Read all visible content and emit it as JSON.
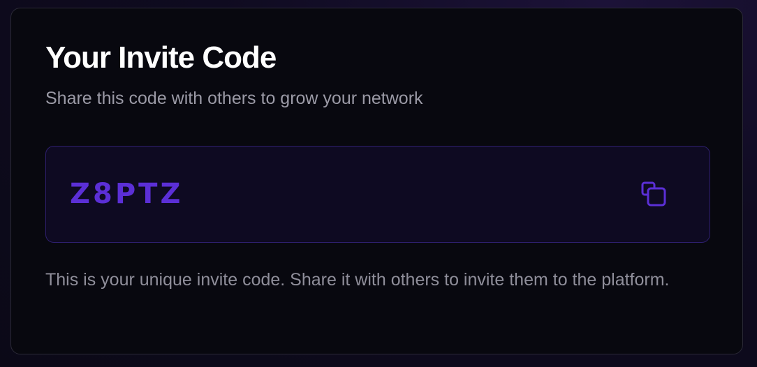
{
  "card": {
    "title": "Your Invite Code",
    "subtitle": "Share this code with others to grow your network",
    "invite_code": "Z8PTZ",
    "copy_icon": "copy-icon",
    "footnote": "This is your unique invite code. Share it with others to invite them to the platform."
  },
  "colors": {
    "accent": "#5b2fd6",
    "card_background": "#08080f",
    "code_box_background": "#0e0a22",
    "code_box_border": "#2e1f6e",
    "muted_text": "#9b9aa6"
  }
}
